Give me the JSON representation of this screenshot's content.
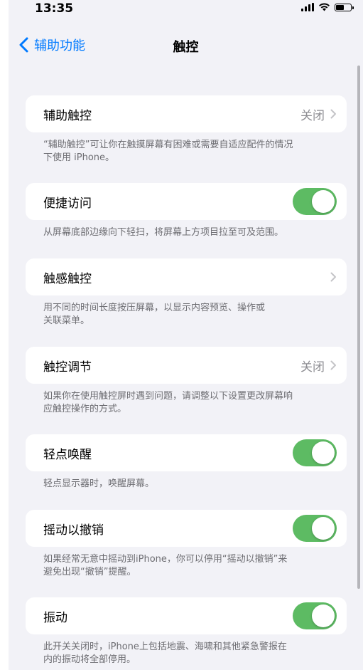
{
  "status": {
    "time": "13:35"
  },
  "nav": {
    "back_label": "辅助功能",
    "title": "触控"
  },
  "sections": [
    {
      "label": "辅助触控",
      "value": "关闭",
      "footer_line1": "“辅助触控”可让你在触摸屏幕有困难或需要自适应配件的情况",
      "footer_line2": "下使用 iPhone。"
    },
    {
      "label": "便捷访问",
      "toggle": "on",
      "footer_line1": "从屏幕底部边缘向下轻扫，将屏幕上方项目拉至可及范围。",
      "footer_line2": ""
    },
    {
      "label": "触感触控",
      "value": "",
      "footer_line1": "用不同的时间长度按压屏幕，以显示内容预览、操作或",
      "footer_line2": "关联菜单。"
    },
    {
      "label": "触控调节",
      "value": "关闭",
      "footer_line1": "如果你在使用触控屏时遇到问题，请调整以下设置更改屏幕响",
      "footer_line2": "应触控操作的方式。"
    },
    {
      "label": "轻点唤醒",
      "toggle": "on",
      "footer_line1": "轻点显示器时，唤醒屏幕。",
      "footer_line2": ""
    },
    {
      "label": "摇动以撤销",
      "toggle": "on",
      "footer_line1": "如果经常无意中摇动到iPhone，你可以停用“摇动以撤销”来",
      "footer_line2": "避免出现“撤销”提醒。"
    },
    {
      "label": "振动",
      "toggle": "on",
      "footer_line1": "此开关关闭时，iPhone上包括地震、海啸和其他紧急警报在",
      "footer_line2": "内的振动将全部停用。"
    }
  ],
  "colors": {
    "accent": "#007aff",
    "toggle_on": "#5dbb63",
    "background": "#f2f2f7",
    "secondary_text": "#8e8e93"
  }
}
